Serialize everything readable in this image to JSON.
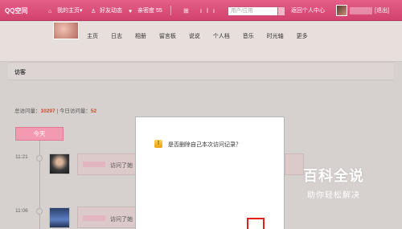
{
  "topbar": {
    "logo": "QQ空间",
    "my_homepage": "我的主页",
    "dropdown_arrow": "▾",
    "friends_dynamic": "好友动态",
    "vip_rank": "亲密度 55",
    "icons": "⊞ ılı",
    "search_placeholder": "用户/应用",
    "return_center": "返回个人中心",
    "logout": "[退出]"
  },
  "nav": {
    "items": [
      "主页",
      "日志",
      "相册",
      "留言板",
      "说说",
      "个人档",
      "音乐",
      "时光轴",
      "更多"
    ]
  },
  "section": {
    "title": "访客",
    "stats_label_total": "总访问量：",
    "stats_total": "10297",
    "stats_divider": " | ",
    "stats_label_today": "今日访问量：",
    "stats_today": "52",
    "today_tab": "今天"
  },
  "visitors": [
    {
      "time": "11:21",
      "action": "访问了她"
    },
    {
      "time": "11:06",
      "action": "访问了她"
    }
  ],
  "dialog": {
    "warning_glyph": "!",
    "message": "是否删除自己本次访问记录？"
  },
  "watermark": {
    "title": "百科全说",
    "subtitle": "助你轻松解决"
  }
}
